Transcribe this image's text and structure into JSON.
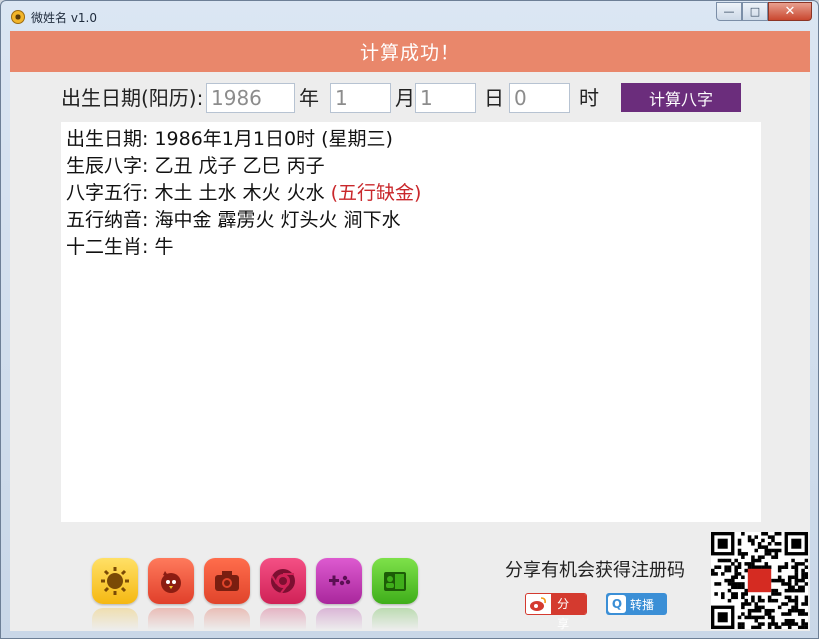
{
  "window": {
    "title": "微姓名 v1.0",
    "buttons": [
      "—",
      "□",
      "✕"
    ]
  },
  "banner": {
    "message": "计算成功！"
  },
  "form": {
    "birth_label": "出生日期(阳历):",
    "year_value": "1986",
    "year_unit": "年",
    "month_value": "1",
    "month_unit": "月",
    "day_value": "1",
    "day_unit": "日",
    "hour_value": "0",
    "hour_unit": "时",
    "calc_button": "计算八字"
  },
  "result": {
    "line1_label": "出生日期:",
    "line1_value": "1986年1月1日0时 (星期三)",
    "line2_label": "生辰八字:",
    "line2_value": "乙丑 戊子 乙巳 丙子",
    "line3_label": "八字五行:",
    "line3_value": "木土 土水 木火 火水",
    "line3_missing": "(五行缺金)",
    "line4_label": "五行纳音:",
    "line4_value": "海中金 霹雳火 灯头火 涧下水",
    "line5_label": "十二生肖:",
    "line5_value": "牛"
  },
  "apps": [
    {
      "name": "sun-app-icon",
      "color": "#f5c417"
    },
    {
      "name": "bird-app-icon",
      "color": "#ef5a3c"
    },
    {
      "name": "camera-app-icon",
      "color": "#ee5436"
    },
    {
      "name": "chrome-app-icon",
      "color": "#e8356a"
    },
    {
      "name": "gamepad-app-icon",
      "color": "#c63fb8"
    },
    {
      "name": "contacts-app-icon",
      "color": "#58c52a"
    }
  ],
  "share": {
    "text": "分享有机会获得注册码",
    "weibo_label": "分享",
    "qq_label": "转播"
  },
  "colors": {
    "banner": "#e9876b",
    "calc_button": "#6b2d7c",
    "missing": "#c9272b"
  }
}
